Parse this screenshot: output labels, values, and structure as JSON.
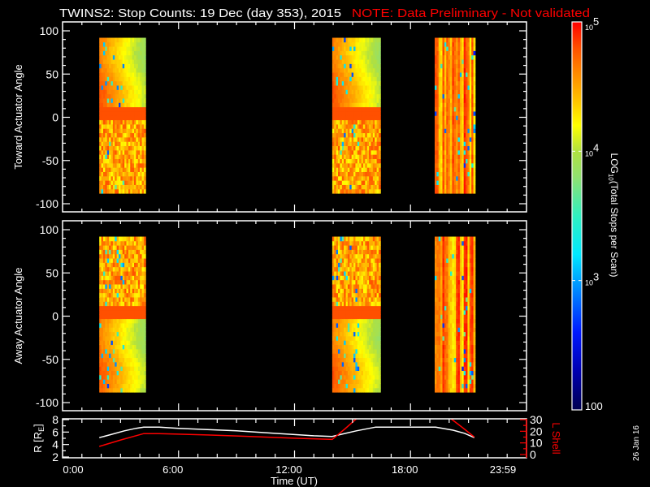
{
  "title": {
    "main": "TWINS2: Stop Counts: 19 Dec (day 353), 2015",
    "note": "NOTE: Data Preliminary - Not validated"
  },
  "colors": {
    "background": "#000000",
    "axes": "#ffffff",
    "note": "#ff0000",
    "lshell": "#ff0000",
    "radius": "#ffffff"
  },
  "chart_data": [
    {
      "type": "heatmap",
      "name": "toward",
      "ylabel": "Toward Actuator Angle",
      "ylim": [
        -110,
        110
      ],
      "yticks": [
        "100",
        "50",
        "0",
        "-50",
        "-100"
      ],
      "ytick_values": [
        100,
        50,
        0,
        -50,
        -100
      ],
      "xlim_hours": [
        0,
        24
      ],
      "angle_range": [
        -88,
        90
      ],
      "time_blocks_hours": [
        [
          1.9,
          4.25
        ],
        [
          13.95,
          16.4
        ],
        [
          19.25,
          21.3
        ]
      ],
      "value_scale": "log10",
      "value_range": [
        2,
        5
      ]
    },
    {
      "type": "heatmap",
      "name": "away",
      "ylabel": "Away Actuator Angle",
      "ylim": [
        -110,
        110
      ],
      "yticks": [
        "100",
        "50",
        "0",
        "-50",
        "-100"
      ],
      "ytick_values": [
        100,
        50,
        0,
        -50,
        -100
      ],
      "xlim_hours": [
        0,
        24
      ],
      "angle_range": [
        -88,
        90
      ],
      "time_blocks_hours": [
        [
          1.9,
          4.25
        ],
        [
          13.95,
          16.4
        ],
        [
          19.25,
          21.3
        ]
      ],
      "value_scale": "log10",
      "value_range": [
        2,
        5
      ]
    },
    {
      "type": "line",
      "name": "orbit",
      "xlabel": "Time (UT)",
      "xticks": [
        "0:00",
        "6:00",
        "12:00",
        "18:00",
        "23:59"
      ],
      "xtick_hours": [
        0,
        6,
        12,
        18,
        24
      ],
      "ylabel": {
        "pre": "R [R",
        "sub": "E",
        "post": "]"
      },
      "ylim": [
        2,
        8
      ],
      "yticks": [
        "8",
        "6",
        "4",
        "2"
      ],
      "ytick_values": [
        8,
        6,
        4,
        2
      ],
      "y2label": "L Shell",
      "y2lim": [
        0,
        30
      ],
      "y2ticks": [
        "30",
        "20",
        "10",
        "0"
      ],
      "y2tick_values": [
        30,
        20,
        10,
        0
      ],
      "series": [
        {
          "name": "R",
          "axis": "left",
          "points": [
            [
              1.9,
              5.1
            ],
            [
              2.5,
              5.6
            ],
            [
              3.2,
              6.2
            ],
            [
              3.8,
              6.6
            ],
            [
              4.2,
              6.8
            ],
            [
              5.0,
              6.8
            ],
            [
              6.0,
              6.6
            ],
            [
              7.5,
              6.4
            ],
            [
              9.0,
              6.2
            ],
            [
              10.5,
              5.9
            ],
            [
              12.0,
              5.6
            ],
            [
              13.0,
              5.4
            ],
            [
              13.95,
              5.3
            ],
            [
              14.5,
              5.7
            ],
            [
              15.2,
              6.2
            ],
            [
              16.2,
              6.8
            ],
            [
              19.3,
              6.8
            ],
            [
              20.2,
              6.3
            ],
            [
              20.8,
              5.8
            ],
            [
              21.3,
              5.1
            ]
          ]
        },
        {
          "name": "L Shell",
          "axis": "right",
          "points": [
            [
              1.9,
              7
            ],
            [
              3.0,
              12.5
            ],
            [
              4.2,
              18
            ],
            [
              5.0,
              18
            ],
            [
              6.0,
              17.5
            ],
            [
              7.5,
              16.8
            ],
            [
              9.0,
              16
            ],
            [
              10.5,
              15
            ],
            [
              12.0,
              14
            ],
            [
              13.0,
              13.5
            ],
            [
              13.95,
              13
            ],
            [
              14.6,
              22
            ],
            [
              15.2,
              30.7
            ]
          ]
        },
        {
          "name": "L Shell (b)",
          "axis": "right",
          "points": [
            [
              20.1,
              30.7
            ],
            [
              20.7,
              23
            ],
            [
              21.3,
              15
            ]
          ]
        }
      ]
    }
  ],
  "colorbar": {
    "label": {
      "pre": "LOG",
      "sub": "10",
      "post": "(Total Stops per Scan)"
    },
    "ticks": [
      {
        "base": "10",
        "exp": "5",
        "log": 5
      },
      {
        "base": "10",
        "exp": "4",
        "log": 4
      },
      {
        "base": "10",
        "exp": "3",
        "log": 3
      }
    ],
    "min_label": "100",
    "range_log": [
      2,
      5
    ]
  },
  "date_stamp": "26 Jan 16"
}
